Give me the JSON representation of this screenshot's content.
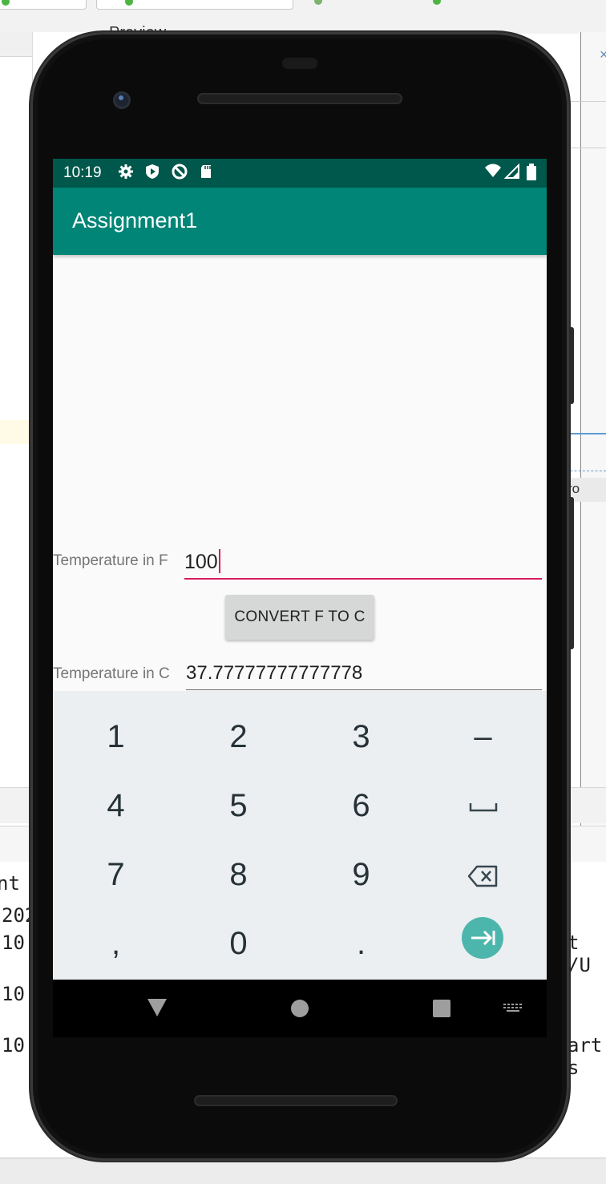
{
  "ide": {
    "preview_tab": "Preview",
    "log_partial": [
      "nt L",
      "202",
      "10:",
      "10:",
      "10:"
    ],
    "log_right": [
      "t /U",
      "art s"
    ],
    "right_panel_text": "ro"
  },
  "status_bar": {
    "time": "10:19",
    "icons": [
      "settings-icon",
      "play-protect-icon",
      "no-sync-icon",
      "sd-card-icon",
      "wifi-icon",
      "signal-icon",
      "battery-icon"
    ]
  },
  "app_bar": {
    "title": "Assignment1"
  },
  "form": {
    "fahrenheit_label": "Temperature in F",
    "fahrenheit_value": "100",
    "convert_button": "CONVERT F TO C",
    "celsius_label": "Temperature in C",
    "celsius_value": "37.77777777777778"
  },
  "keypad": {
    "keys": [
      "1",
      "2",
      "3",
      "–",
      "4",
      "5",
      "6",
      "␣",
      "7",
      "8",
      "9",
      "⌫",
      ",",
      "0",
      ".",
      "⇥"
    ]
  },
  "colors": {
    "status_bar": "#00574b",
    "app_bar": "#008577",
    "accent": "#d81b60",
    "enter_key": "#4db6ac"
  }
}
